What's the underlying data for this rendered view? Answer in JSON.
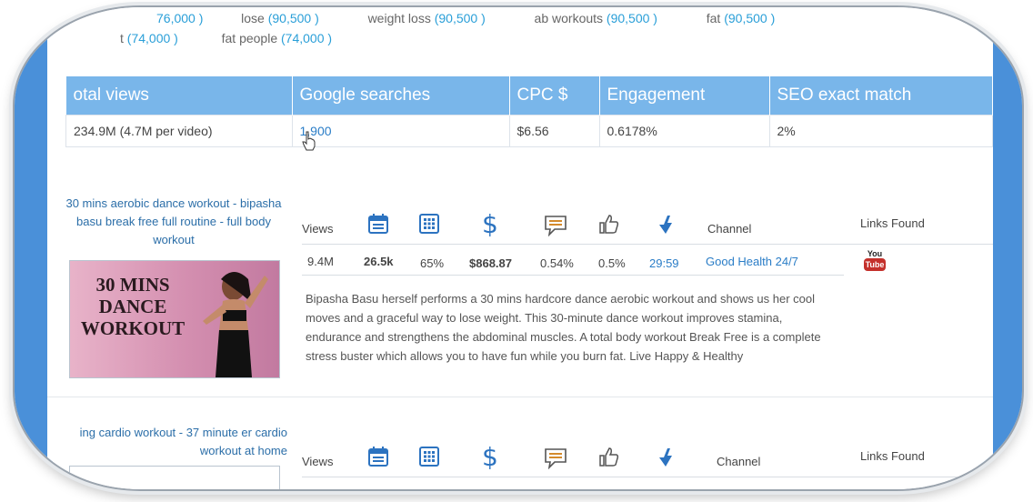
{
  "keywords_row1": [
    {
      "kw": "",
      "num": "76,000 )"
    },
    {
      "kw": "lose ",
      "num": "(90,500 )"
    },
    {
      "kw": "weight loss ",
      "num": "(90,500 )"
    },
    {
      "kw": "ab workouts ",
      "num": "(90,500 )"
    },
    {
      "kw": "fat ",
      "num": "(90,500 )"
    }
  ],
  "keywords_row2": [
    {
      "kw": "t ",
      "num": "(74,000 )"
    },
    {
      "kw": "fat people ",
      "num": "(74,000 )"
    }
  ],
  "metrics": {
    "headers": [
      "otal views",
      "Google searches",
      "CPC $",
      "Engagement",
      "SEO exact match"
    ],
    "values": [
      "234.9M (4.7M per video)",
      "1,900",
      "$6.56",
      "0.6178%",
      "2%"
    ]
  },
  "video1": {
    "title": "30 mins aerobic dance workout - bipasha basu break free full routine - full body workout",
    "thumb_text": "30 MINS DANCE WORKOUT",
    "views_label": "Views",
    "channel_label": "Channel",
    "links_label": "Links Found",
    "stats": {
      "views": "9.4M",
      "per_day": "26.5k",
      "percent": "65%",
      "earnings": "$868.87",
      "comments": "0.54%",
      "likes": "0.5%",
      "duration": "29:59",
      "channel": "Good Health 24/7"
    },
    "youtube_top": "You",
    "youtube_bottom": "Tube",
    "description": "Bipasha Basu herself performs a 30 mins hardcore dance aerobic workout and shows us her cool moves and a graceful way to lose weight. This 30-minute dance workout improves stamina, endurance and strengthens the abdominal muscles. A total body workout Break Free is a complete stress buster which allows you to have fun while you burn fat. Live Happy & Healthy"
  },
  "video2": {
    "title": "ing cardio workout - 37 minute er cardio workout at home",
    "views_label": "Views",
    "channel_label": "Channel",
    "links_label": "Links Found"
  },
  "colors": {
    "header_blue": "#79b6ea",
    "frame_blue": "#4a90d9",
    "link_blue": "#2a7dc7",
    "icon_blue": "#2c73c0"
  }
}
